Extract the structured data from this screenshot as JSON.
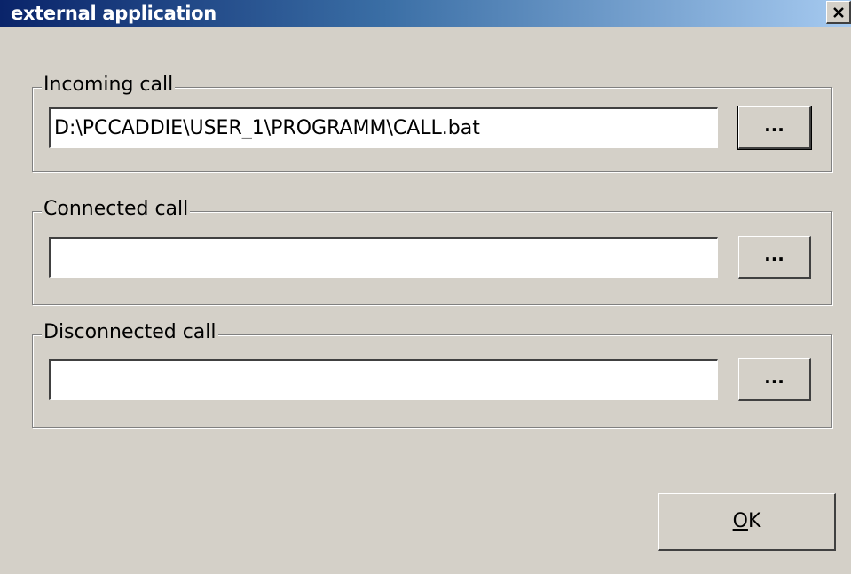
{
  "window": {
    "title": "external application",
    "close_icon": "close-x-icon"
  },
  "groups": [
    {
      "label": "Incoming call",
      "value": "D:\\PCCADDIE\\USER_1\\PROGRAMM\\CALL.bat",
      "browse_label": "..."
    },
    {
      "label": "Connected call",
      "value": "",
      "browse_label": "..."
    },
    {
      "label": "Disconnected call",
      "value": "",
      "browse_label": "..."
    }
  ],
  "ok_button": {
    "mnemonic": "O",
    "rest": "K"
  },
  "colors": {
    "face": "#d4d0c8",
    "title_start": "#0a246a",
    "title_end": "#a6caf0"
  }
}
